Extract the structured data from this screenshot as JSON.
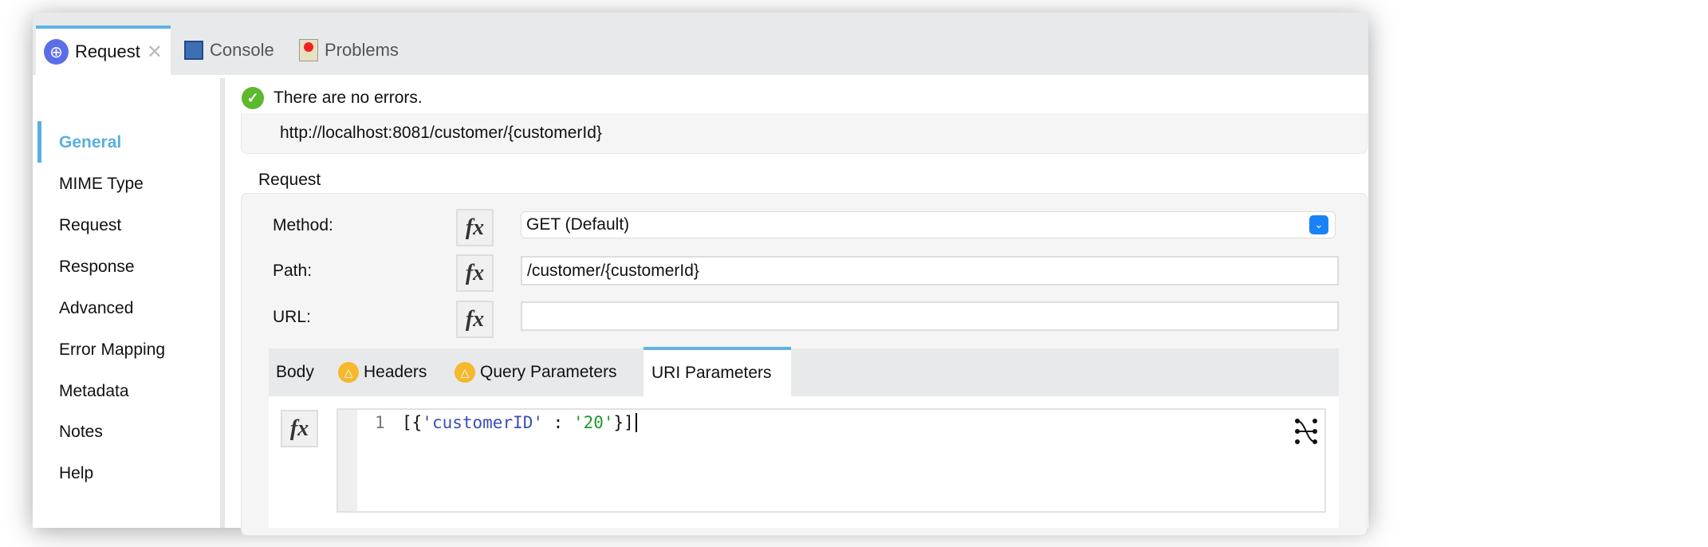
{
  "tabs": [
    {
      "label": "Request",
      "icon": "globe-icon",
      "closable": true
    },
    {
      "label": "Console",
      "icon": "monitor-icon"
    },
    {
      "label": "Problems",
      "icon": "problems-icon"
    }
  ],
  "sidebar": {
    "items": [
      {
        "label": "General",
        "active": true
      },
      {
        "label": "MIME Type"
      },
      {
        "label": "Request"
      },
      {
        "label": "Response"
      },
      {
        "label": "Advanced"
      },
      {
        "label": "Error Mapping"
      },
      {
        "label": "Metadata"
      },
      {
        "label": "Notes"
      },
      {
        "label": "Help"
      }
    ]
  },
  "status": {
    "message": "There are no errors.",
    "url": "http://localhost:8081/customer/{customerId}"
  },
  "request": {
    "section_title": "Request",
    "method_label": "Method:",
    "method_value": "GET (Default)",
    "path_label": "Path:",
    "path_value": "/customer/{customerId}",
    "url_label": "URL:",
    "url_value": "",
    "fx_label": "fx"
  },
  "param_tabs": [
    {
      "label": "Body"
    },
    {
      "label": "Headers",
      "warning": true
    },
    {
      "label": "Query Parameters",
      "warning": true
    },
    {
      "label": "URI Parameters",
      "active": true
    }
  ],
  "editor": {
    "line_number": "1",
    "tokens": {
      "open": "[{",
      "key": "'customerID'",
      "sep": " : ",
      "value": "'20'",
      "close": "}]"
    }
  },
  "colors": {
    "accent": "#5aafdf",
    "key": "#3a4fb0",
    "string": "#1a9a2a",
    "warning": "#f5b82e"
  }
}
